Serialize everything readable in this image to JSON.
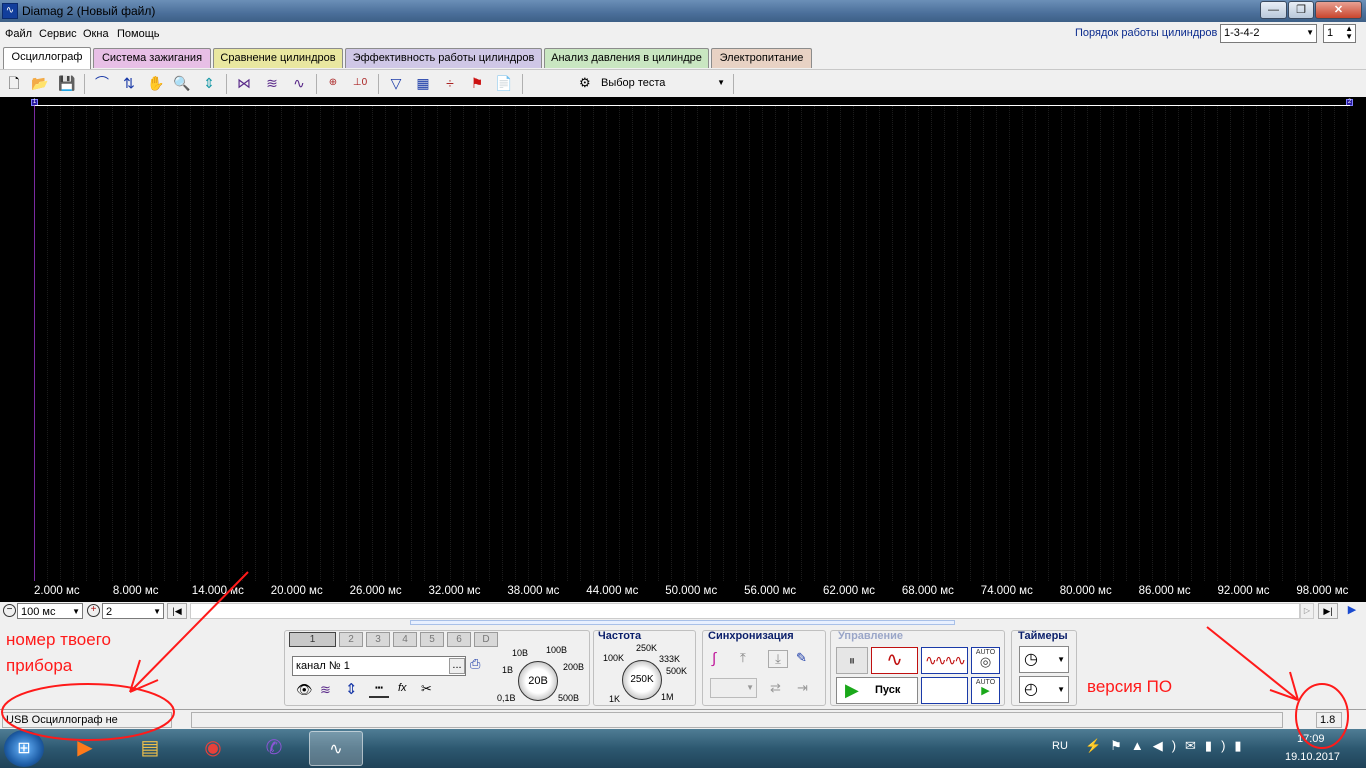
{
  "window": {
    "title": "Diamag 2 (Новый файл)",
    "minimize": "—",
    "maximize": "❐",
    "close": "✕"
  },
  "menu": {
    "items": [
      "Файл",
      "Сервис",
      "Окна",
      "Помощь"
    ]
  },
  "cylinders": {
    "label": "Порядок работы цилиндров",
    "order_value": "1-3-4-2",
    "count_value": "1"
  },
  "tabs": [
    {
      "label": "Осциллограф",
      "color": "#ffffff"
    },
    {
      "label": "Система зажигания",
      "color": "#e7bfe6"
    },
    {
      "label": "Сравнение цилиндров",
      "color": "#e9e7a0"
    },
    {
      "label": "Эффективность работы цилиндров",
      "color": "#cfc7e6"
    },
    {
      "label": "Анализ давления в цилиндре",
      "color": "#c9e6c1"
    },
    {
      "label": "Электропитание",
      "color": "#e8d2c4"
    }
  ],
  "toolbar": {
    "test_select": "Выбор теста"
  },
  "scope": {
    "marker_left": "1",
    "marker_right": "2"
  },
  "axis_ticks": [
    "2.000 мс",
    "8.000 мс",
    "14.000 мс",
    "20.000 мс",
    "26.000 мс",
    "32.000 мс",
    "38.000 мс",
    "44.000 мс",
    "50.000 мс",
    "56.000 мс",
    "62.000 мс",
    "68.000 мс",
    "74.000 мс",
    "80.000 мс",
    "86.000 мс",
    "92.000 мс",
    "98.000 мс"
  ],
  "controls": {
    "timebase": "100 мс",
    "zoom": "2"
  },
  "channel": {
    "buttons": [
      "1",
      "2",
      "3",
      "4",
      "5",
      "6",
      "D"
    ],
    "name": "канал № 1",
    "name_btn": "...",
    "knob_value": "20В",
    "scale_labels": [
      "10В",
      "100В",
      "1В",
      "200В",
      "0,1В",
      "500В"
    ]
  },
  "frequency": {
    "title": "Частота",
    "knob_value": "250K",
    "labels": [
      "250K",
      "100K",
      "333K",
      "500K",
      "1K",
      "1M"
    ]
  },
  "sync": {
    "title": "Синхронизация"
  },
  "control": {
    "title": "Управление",
    "start": "Пуск",
    "auto1": "AUTO",
    "auto2": "AUTO"
  },
  "timers": {
    "title": "Таймеры"
  },
  "status": {
    "usb": "USB Осциллограф не подключен",
    "version": "1.8"
  },
  "annotations": {
    "device_number": "номер твоего прибора",
    "version_label": "версия ПО"
  },
  "taskbar": {
    "lang": "RU",
    "time": "17:09",
    "date": "19.10.2017"
  },
  "colors": {
    "plot_bg": "#000000",
    "annotation": "#ff1a1a",
    "title_accent": "#0b1f6b"
  }
}
